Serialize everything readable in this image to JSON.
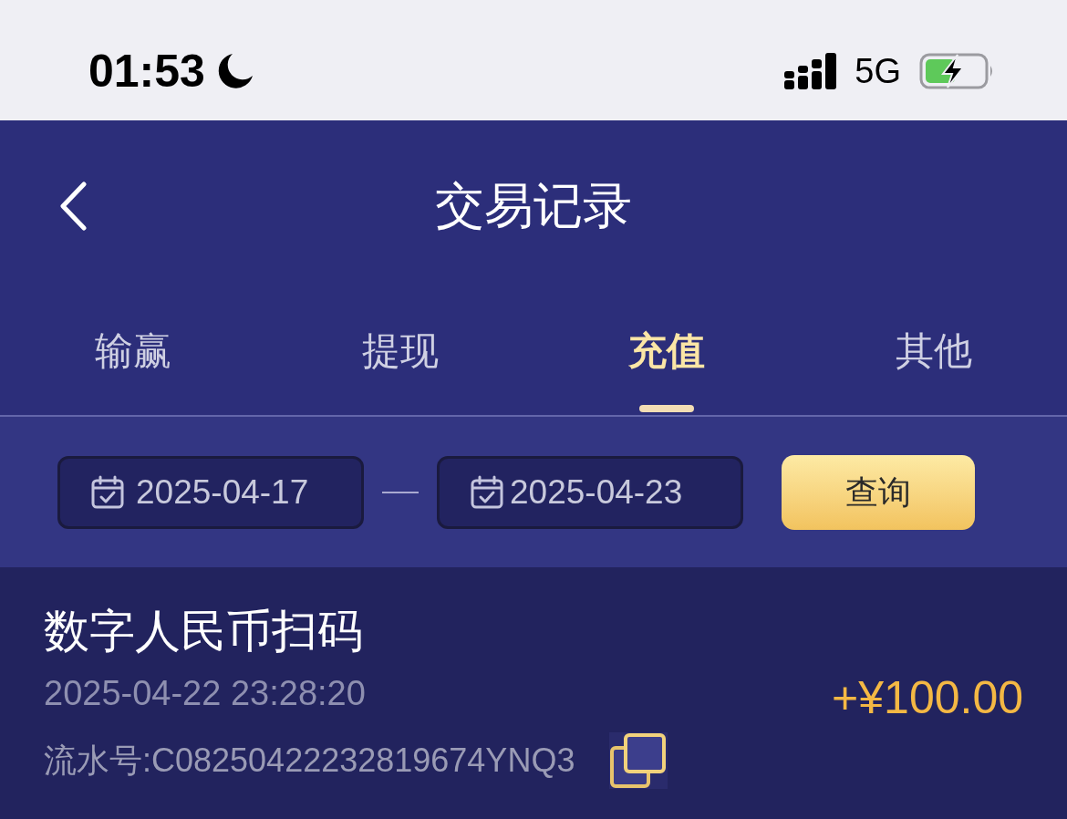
{
  "status_bar": {
    "time": "01:53",
    "network": "5G"
  },
  "nav_bar": {
    "title": "交易记录"
  },
  "tabs": [
    {
      "label": "输赢",
      "selected": false
    },
    {
      "label": "提现",
      "selected": false
    },
    {
      "label": "充值",
      "selected": true
    },
    {
      "label": "其他",
      "selected": false
    }
  ],
  "date_filter": {
    "start_date": "2025-04-17",
    "end_date": "2025-04-23",
    "query_button": "查询"
  },
  "transactions": [
    {
      "title": "数字人民币扫码",
      "time": "2025-04-22 23:28:20",
      "serial": "流水号:C08250422232819674YNQ3",
      "amount": "+¥100.00"
    }
  ]
}
